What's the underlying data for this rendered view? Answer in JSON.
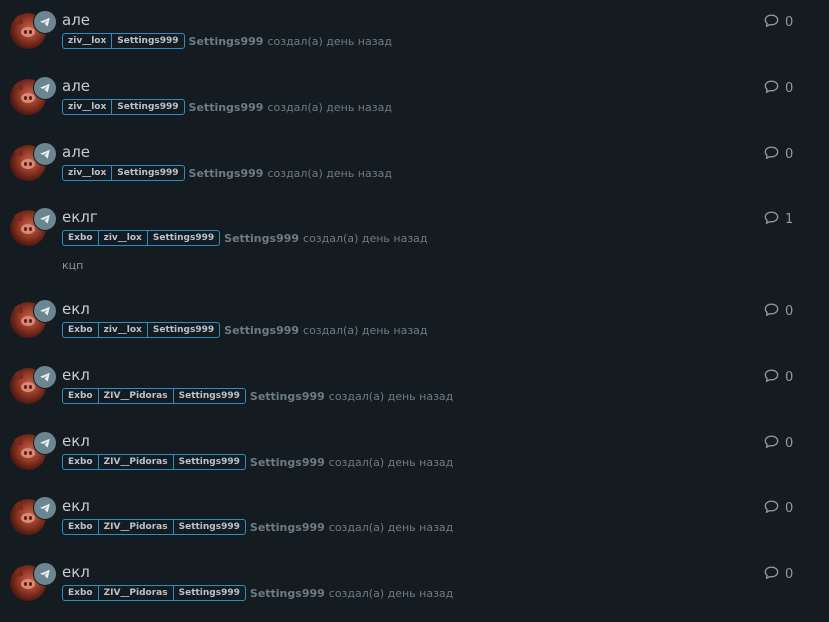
{
  "threads": [
    {
      "title": "але",
      "tags": [
        "ziv__lox",
        "Settings999"
      ],
      "author": "Settings999",
      "created": "создал(а) день назад",
      "snippet": "",
      "replies": "0"
    },
    {
      "title": "але",
      "tags": [
        "ziv__lox",
        "Settings999"
      ],
      "author": "Settings999",
      "created": "создал(а) день назад",
      "snippet": "",
      "replies": "0"
    },
    {
      "title": "але",
      "tags": [
        "ziv__lox",
        "Settings999"
      ],
      "author": "Settings999",
      "created": "создал(а) день назад",
      "snippet": "",
      "replies": "0"
    },
    {
      "title": "еклг",
      "tags": [
        "Exbo",
        "ziv__lox",
        "Settings999"
      ],
      "author": "Settings999",
      "created": "создал(а) день назад",
      "snippet": "кцп",
      "replies": "1"
    },
    {
      "title": "екл",
      "tags": [
        "Exbo",
        "ziv__lox",
        "Settings999"
      ],
      "author": "Settings999",
      "created": "создал(а) день назад",
      "snippet": "",
      "replies": "0"
    },
    {
      "title": "екл",
      "tags": [
        "Exbo",
        "ZIV__Pidoras",
        "Settings999"
      ],
      "author": "Settings999",
      "created": "создал(а) день назад",
      "snippet": "",
      "replies": "0"
    },
    {
      "title": "екл",
      "tags": [
        "Exbo",
        "ZIV__Pidoras",
        "Settings999"
      ],
      "author": "Settings999",
      "created": "создал(а) день назад",
      "snippet": "",
      "replies": "0"
    },
    {
      "title": "екл",
      "tags": [
        "Exbo",
        "ZIV__Pidoras",
        "Settings999"
      ],
      "author": "Settings999",
      "created": "создал(а) день назад",
      "snippet": "",
      "replies": "0"
    },
    {
      "title": "екл",
      "tags": [
        "Exbo",
        "ZIV__Pidoras",
        "Settings999"
      ],
      "author": "Settings999",
      "created": "создал(а) день назад",
      "snippet": "",
      "replies": "0"
    }
  ],
  "icons": {
    "avatar_badge": "telegram-icon",
    "replies": "comment-icon"
  },
  "colors": {
    "background": "#151c21",
    "tag_border": "#2b8fc4",
    "badge": "#6b8591"
  }
}
